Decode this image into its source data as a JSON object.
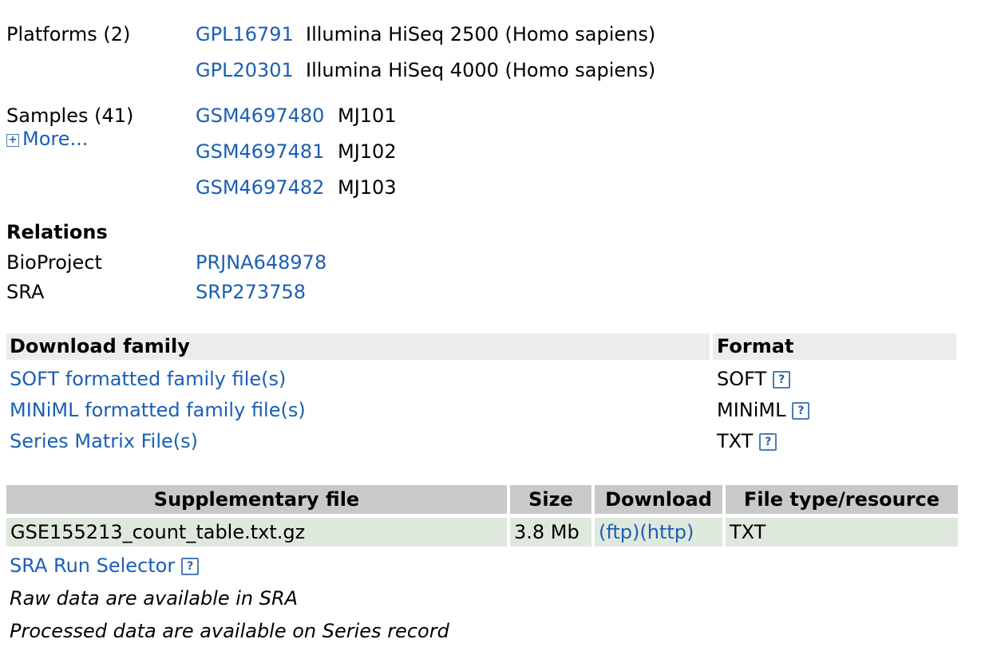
{
  "platforms": {
    "label": "Platforms (2)",
    "items": [
      {
        "id": "GPL16791",
        "title": "Illumina HiSeq 2500 (Homo sapiens)"
      },
      {
        "id": "GPL20301",
        "title": "Illumina HiSeq 4000 (Homo sapiens)"
      }
    ]
  },
  "samples": {
    "label": "Samples (41)",
    "more_label": "More...",
    "items": [
      {
        "id": "GSM4697480",
        "title": "MJ101"
      },
      {
        "id": "GSM4697481",
        "title": "MJ102"
      },
      {
        "id": "GSM4697482",
        "title": "MJ103"
      }
    ]
  },
  "relations": {
    "heading": "Relations",
    "items": [
      {
        "label": "BioProject",
        "value": "PRJNA648978"
      },
      {
        "label": "SRA",
        "value": "SRP273758"
      }
    ]
  },
  "download_family": {
    "header": "Download family",
    "format_header": "Format",
    "rows": [
      {
        "label": "SOFT formatted family file(s)",
        "format": "SOFT"
      },
      {
        "label": "MINiML formatted family file(s)",
        "format": "MINiML"
      },
      {
        "label": "Series Matrix File(s)",
        "format": "TXT"
      }
    ]
  },
  "supplementary": {
    "headers": {
      "file": "Supplementary file",
      "size": "Size",
      "download": "Download",
      "type": "File type/resource"
    },
    "rows": [
      {
        "file": "GSE155213_count_table.txt.gz",
        "size": "3.8 Mb",
        "ftp": "(ftp)",
        "http": "(http)",
        "type": "TXT"
      }
    ],
    "sra_selector": "SRA Run Selector",
    "notes": [
      "Raw data are available in SRA",
      "Processed data are available on Series record"
    ]
  },
  "help_glyph": "?",
  "plus_glyph": "+"
}
